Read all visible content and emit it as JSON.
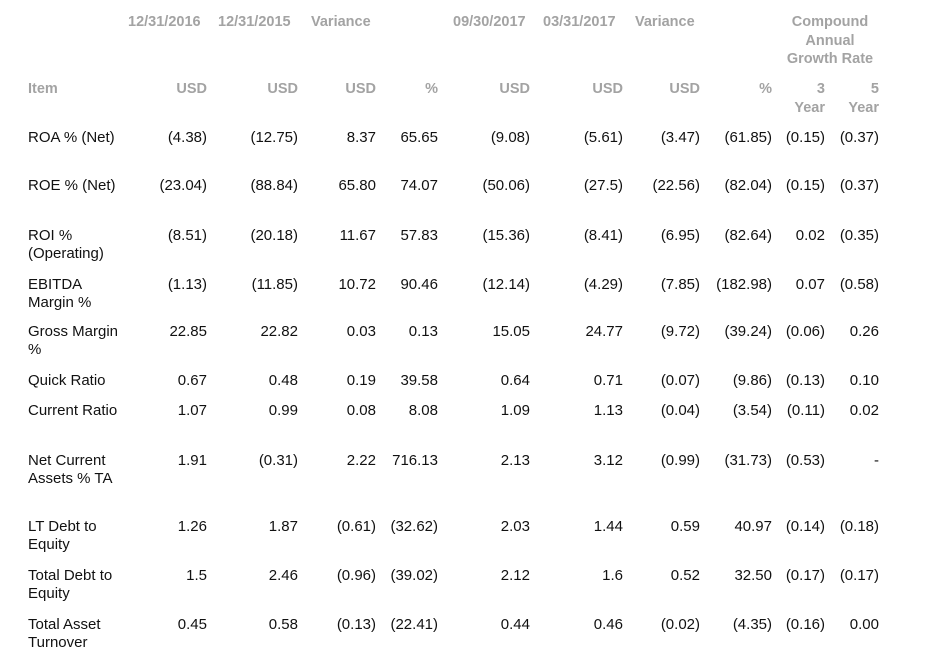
{
  "header": {
    "period_1": "12/31/2016",
    "period_2": "12/31/2015",
    "variance_1": "Variance",
    "period_3": "09/30/2017",
    "period_4": "03/31/2017",
    "variance_2": "Variance",
    "cagr_line1": "Compound",
    "cagr_line2": "Annual",
    "cagr_line3": "Growth Rate"
  },
  "subheader": {
    "item": "Item",
    "c1": "USD",
    "c2": "USD",
    "c3": "USD",
    "c4": "%",
    "c5": "USD",
    "c6": "USD",
    "c7": "USD",
    "c8": "%",
    "c9_num": "3",
    "c9_unit": "Year",
    "c10_num": "5",
    "c10_unit": "Year"
  },
  "rows": [
    {
      "label": "ROA % (Net)",
      "values": [
        "(4.38)",
        "(12.75)",
        "8.37",
        "65.65",
        "(9.08)",
        "(5.61)",
        "(3.47)",
        "(61.85)",
        "(0.15)",
        "(0.37)"
      ]
    },
    {
      "label": "ROE % (Net)",
      "values": [
        "(23.04)",
        "(88.84)",
        "65.80",
        "74.07",
        "(50.06)",
        "(27.5)",
        "(22.56)",
        "(82.04)",
        "(0.15)",
        "(0.37)"
      ]
    },
    {
      "label": "ROI % (Operating)",
      "values": [
        "(8.51)",
        "(20.18)",
        "11.67",
        "57.83",
        "(15.36)",
        "(8.41)",
        "(6.95)",
        "(82.64)",
        "0.02",
        "(0.35)"
      ]
    },
    {
      "label": "EBITDA Margin %",
      "values": [
        "(1.13)",
        "(11.85)",
        "10.72",
        "90.46",
        "(12.14)",
        "(4.29)",
        "(7.85)",
        "(182.98)",
        "0.07",
        "(0.58)"
      ]
    },
    {
      "label": "Gross Margin %",
      "values": [
        "22.85",
        "22.82",
        "0.03",
        "0.13",
        "15.05",
        "24.77",
        "(9.72)",
        "(39.24)",
        "(0.06)",
        "0.26"
      ]
    },
    {
      "label": "Quick Ratio",
      "values": [
        "0.67",
        "0.48",
        "0.19",
        "39.58",
        "0.64",
        "0.71",
        "(0.07)",
        "(9.86)",
        "(0.13)",
        "0.10"
      ]
    },
    {
      "label": "Current Ratio",
      "values": [
        "1.07",
        "0.99",
        "0.08",
        "8.08",
        "1.09",
        "1.13",
        "(0.04)",
        "(3.54)",
        "(0.11)",
        "0.02"
      ]
    },
    {
      "label": "Net Current Assets % TA",
      "values": [
        "1.91",
        "(0.31)",
        "2.22",
        "716.13",
        "2.13",
        "3.12",
        "(0.99)",
        "(31.73)",
        "(0.53)",
        "-"
      ]
    },
    {
      "label": "LT Debt to Equity",
      "values": [
        "1.26",
        "1.87",
        "(0.61)",
        "(32.62)",
        "2.03",
        "1.44",
        "0.59",
        "40.97",
        "(0.14)",
        "(0.18)"
      ]
    },
    {
      "label": "Total Debt to Equity",
      "values": [
        "1.5",
        "2.46",
        "(0.96)",
        "(39.02)",
        "2.12",
        "1.6",
        "0.52",
        "32.50",
        "(0.17)",
        "(0.17)"
      ]
    },
    {
      "label": "Total Asset Turnover",
      "values": [
        "0.45",
        "0.58",
        "(0.13)",
        "(22.41)",
        "0.44",
        "0.46",
        "(0.02)",
        "(4.35)",
        "(0.16)",
        "0.00"
      ]
    }
  ]
}
